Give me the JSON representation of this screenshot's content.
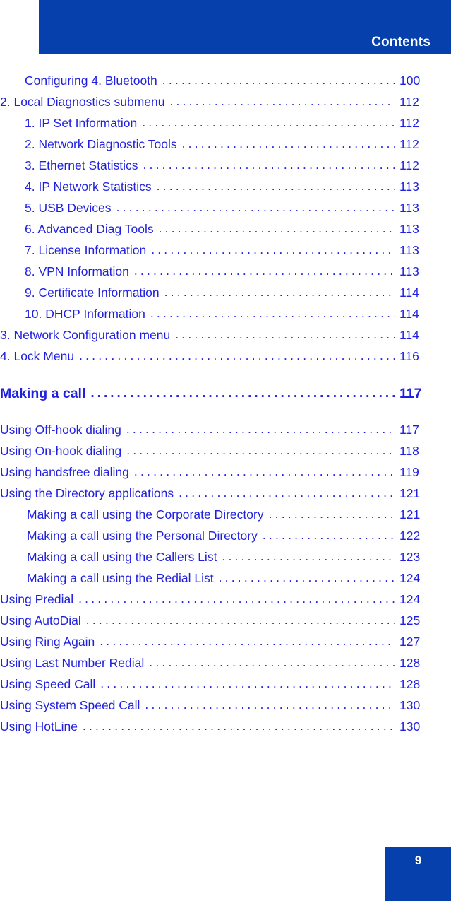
{
  "header": {
    "title": "Contents",
    "band_color": "#0540ac"
  },
  "colors": {
    "brand_blue": "#0540ac",
    "link_blue": "#1f1fe0",
    "page_background": "#ffffff"
  },
  "footer": {
    "page_number": "9"
  },
  "toc": {
    "entries": [
      {
        "label": "Configuring 4. Bluetooth",
        "page": "100",
        "level": 1,
        "bold": false,
        "gap_before": false
      },
      {
        "label": "2. Local Diagnostics submenu",
        "page": "112",
        "level": 0,
        "bold": false,
        "gap_before": false
      },
      {
        "label": "1. IP Set Information",
        "page": "112",
        "level": 1,
        "bold": false,
        "gap_before": false
      },
      {
        "label": "2. Network Diagnostic Tools",
        "page": "112",
        "level": 1,
        "bold": false,
        "gap_before": false
      },
      {
        "label": "3. Ethernet Statistics",
        "page": "112",
        "level": 1,
        "bold": false,
        "gap_before": false
      },
      {
        "label": "4. IP Network Statistics",
        "page": "113",
        "level": 1,
        "bold": false,
        "gap_before": false
      },
      {
        "label": "5. USB Devices",
        "page": "113",
        "level": 1,
        "bold": false,
        "gap_before": false
      },
      {
        "label": "6. Advanced Diag Tools",
        "page": "113",
        "level": 1,
        "bold": false,
        "gap_before": false
      },
      {
        "label": "7. License Information",
        "page": "113",
        "level": 1,
        "bold": false,
        "gap_before": false
      },
      {
        "label": "8. VPN Information",
        "page": "113",
        "level": 1,
        "bold": false,
        "gap_before": false
      },
      {
        "label": "9. Certificate Information",
        "page": "114",
        "level": 1,
        "bold": false,
        "gap_before": false
      },
      {
        "label": "10. DHCP Information",
        "page": "114",
        "level": 1,
        "bold": false,
        "gap_before": false
      },
      {
        "label": "3. Network Configuration menu",
        "page": "114",
        "level": 0,
        "bold": false,
        "gap_before": false
      },
      {
        "label": "4. Lock Menu",
        "page": "116",
        "level": 0,
        "bold": false,
        "gap_before": false
      },
      {
        "label": "Making a call",
        "page": "117",
        "level": 0,
        "bold": true,
        "gap_before": true
      },
      {
        "label": "Using Off-hook dialing",
        "page": "117",
        "level": 0,
        "bold": false,
        "gap_before": true
      },
      {
        "label": "Using On-hook dialing",
        "page": "118",
        "level": 0,
        "bold": false,
        "gap_before": false
      },
      {
        "label": "Using handsfree dialing",
        "page": "119",
        "level": 0,
        "bold": false,
        "gap_before": false
      },
      {
        "label": "Using the Directory applications",
        "page": "121",
        "level": 0,
        "bold": false,
        "gap_before": false
      },
      {
        "label": "Making a call using the Corporate Directory",
        "page": "121",
        "level": 2,
        "bold": false,
        "gap_before": false
      },
      {
        "label": "Making a call using the Personal Directory",
        "page": "122",
        "level": 2,
        "bold": false,
        "gap_before": false
      },
      {
        "label": "Making a call using the Callers List",
        "page": "123",
        "level": 2,
        "bold": false,
        "gap_before": false
      },
      {
        "label": "Making a call using the Redial List",
        "page": "124",
        "level": 2,
        "bold": false,
        "gap_before": false
      },
      {
        "label": "Using Predial",
        "page": "124",
        "level": 0,
        "bold": false,
        "gap_before": false
      },
      {
        "label": "Using AutoDial",
        "page": "125",
        "level": 0,
        "bold": false,
        "gap_before": false
      },
      {
        "label": "Using Ring Again",
        "page": "127",
        "level": 0,
        "bold": false,
        "gap_before": false
      },
      {
        "label": "Using Last Number Redial",
        "page": "128",
        "level": 0,
        "bold": false,
        "gap_before": false
      },
      {
        "label": "Using Speed Call",
        "page": "128",
        "level": 0,
        "bold": false,
        "gap_before": false
      },
      {
        "label": "Using System Speed Call",
        "page": "130",
        "level": 0,
        "bold": false,
        "gap_before": false
      },
      {
        "label": "Using HotLine",
        "page": "130",
        "level": 0,
        "bold": false,
        "gap_before": false
      }
    ]
  }
}
